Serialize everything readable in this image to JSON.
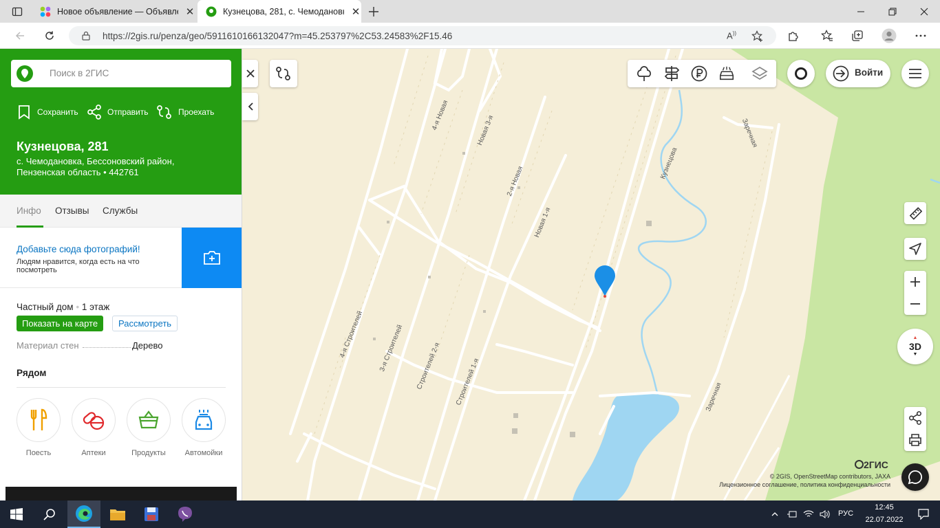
{
  "browser": {
    "tabs": [
      {
        "title": "Новое объявление — Объявле",
        "active": false
      },
      {
        "title": "Кузнецова, 281, с. Чемодановк",
        "active": true
      }
    ],
    "url": "https://2gis.ru/penza/geo/5911610166132047?m=45.253797%2C53.24583%2F15.46"
  },
  "panel": {
    "search_placeholder": "Поиск в 2ГИС",
    "actions": {
      "save": "Сохранить",
      "share": "Отправить",
      "route": "Проехать"
    },
    "title": "Кузнецова, 281",
    "subtitle": "с. Чемодановка, Бессоновский район, Пензенская область • 442761",
    "tabs": {
      "info": "Инфо",
      "reviews": "Отзывы",
      "services": "Службы"
    },
    "photo_cta": {
      "title": "Добавьте сюда фотографий!",
      "subtitle": "Людям нравится, когда есть на что посмотреть"
    },
    "house_type": "Частный дом",
    "floors": "1 этаж",
    "show_on_map": "Показать на карте",
    "view": "Рассмотреть",
    "wall_material_label": "Материал стен",
    "wall_material_value": "Дерево",
    "nearby_title": "Рядом",
    "nearby": [
      {
        "label": "Поесть",
        "icon": "fork-knife-icon",
        "color": "#f0a000"
      },
      {
        "label": "Аптеки",
        "icon": "pills-icon",
        "color": "#e0282b"
      },
      {
        "label": "Продукты",
        "icon": "basket-icon",
        "color": "#4aa52e"
      },
      {
        "label": "Автомойки",
        "icon": "car-wash-icon",
        "color": "#1c8ae6"
      }
    ]
  },
  "map": {
    "streets": [
      "4-я Новая",
      "Новая 3-я",
      "2-я Новая",
      "Новая 1-я",
      "Кузнецова",
      "Заречная",
      "Заречная",
      "4-я Строителей",
      "3-я Строителей",
      "Строителей 2-я",
      "Строителей 1-я"
    ],
    "login_label": "Войти",
    "toggle_3d": "3D",
    "logo": "2ГИС",
    "copyright_line1": "© 2GIS, OpenStreetMap contributors, JAXA",
    "copyright_line2": "Лицензионное соглашение, политика конфиденциальности",
    "colors": {
      "land": "#f5eed8",
      "forest": "#c9e6a3",
      "water": "#9fd6f2",
      "pin": "#1b8fe6",
      "brand": "#259d12"
    }
  },
  "taskbar": {
    "lang": "РУС",
    "time": "12:45",
    "date": "22.07.2022"
  }
}
